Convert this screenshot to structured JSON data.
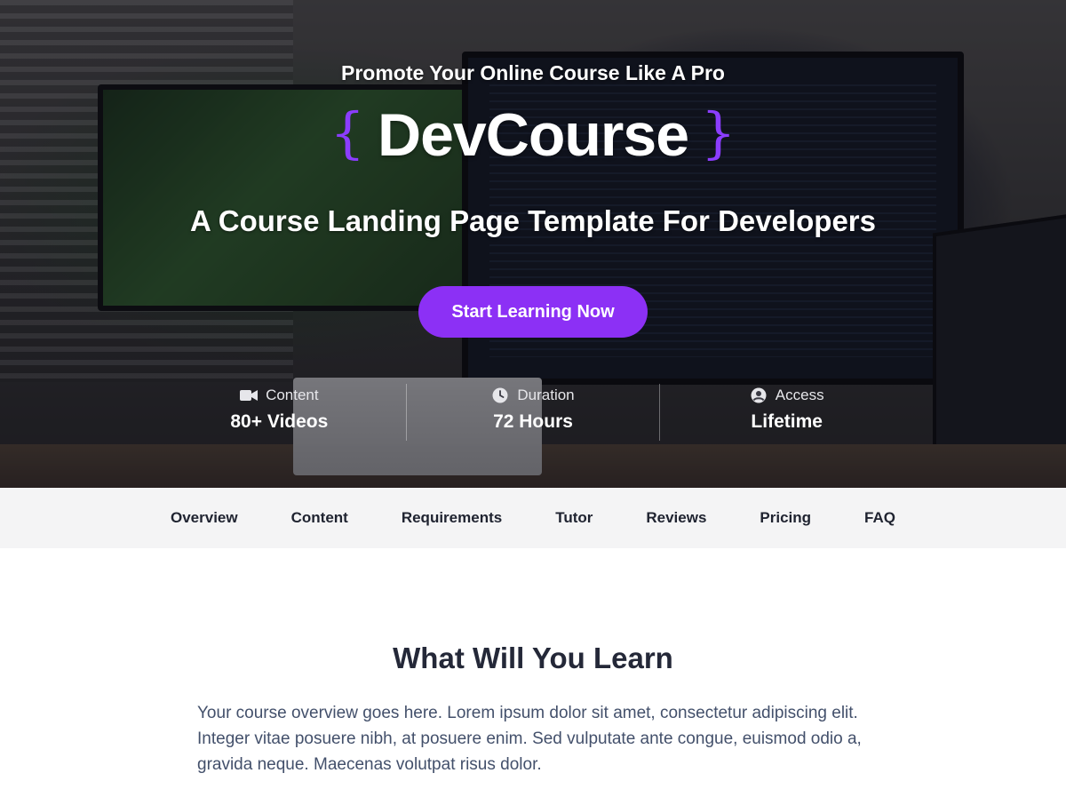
{
  "hero": {
    "tagline": "Promote Your Online Course Like A Pro",
    "brand": {
      "open_brace": "{",
      "name": "DevCourse",
      "close_brace": "}"
    },
    "subtitle": "A Course Landing Page Template For Developers",
    "cta_label": "Start Learning Now",
    "accent_color": "#8c30f5",
    "stats": [
      {
        "icon": "video-camera-icon",
        "label": "Content",
        "value": "80+ Videos"
      },
      {
        "icon": "clock-icon",
        "label": "Duration",
        "value": "72 Hours"
      },
      {
        "icon": "user-circle-icon",
        "label": "Access",
        "value": "Lifetime"
      }
    ]
  },
  "nav": {
    "items": [
      "Overview",
      "Content",
      "Requirements",
      "Tutor",
      "Reviews",
      "Pricing",
      "FAQ"
    ]
  },
  "overview": {
    "title": "What Will You Learn",
    "text": "Your course overview goes here. Lorem ipsum dolor sit amet, consectetur adipiscing elit. Integer vitae posuere nibh, at posuere enim. Sed vulputate ante congue, euismod odio a, gravida neque. Maecenas volutpat risus dolor."
  }
}
